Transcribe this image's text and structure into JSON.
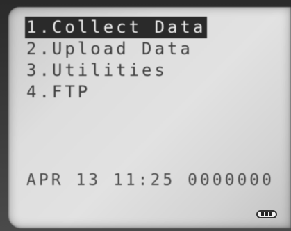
{
  "menu": {
    "items": [
      {
        "label": "1.Collect Data",
        "selected": true
      },
      {
        "label": "2.Upload Data",
        "selected": false
      },
      {
        "label": "3.Utilities",
        "selected": false
      },
      {
        "label": "4.FTP",
        "selected": false
      }
    ]
  },
  "status": {
    "date": "APR 13",
    "time": "11:25",
    "counter": "0000000"
  },
  "battery": {
    "icon": "battery-icon",
    "level": 1.0
  },
  "colors": {
    "screen": "#dedede",
    "text": "#3d3d3d",
    "highlight": "#2a2a2a"
  }
}
